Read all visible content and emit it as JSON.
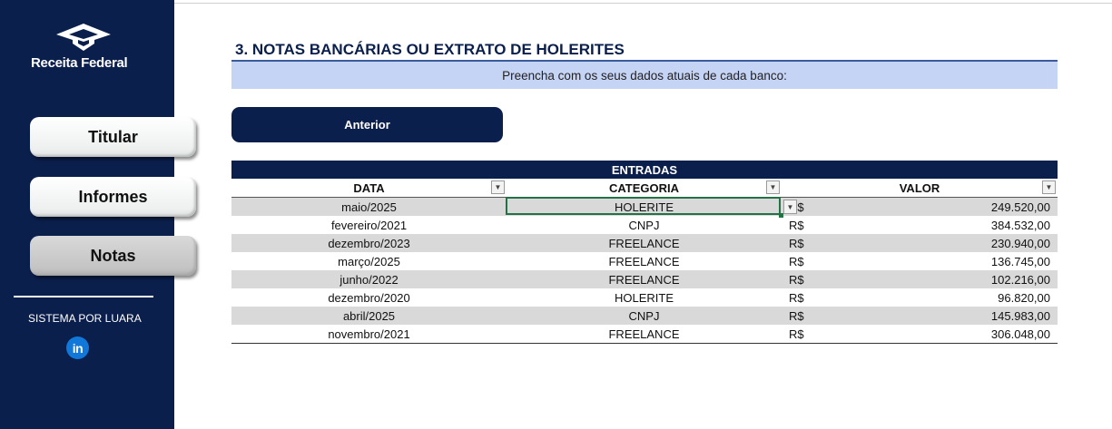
{
  "sidebar": {
    "logo_text": "Receita Federal",
    "nav": [
      {
        "label": "Titular",
        "active": false
      },
      {
        "label": "Informes",
        "active": false
      },
      {
        "label": "Notas",
        "active": true
      }
    ],
    "credit": "SISTEMA POR LUARA",
    "linkedin_icon_text": "in"
  },
  "main": {
    "title": "3. NOTAS BANCÁRIAS OU EXTRATO DE HOLERITES",
    "info": "Preencha com os seus dados atuais de cada banco:",
    "prev_button": "Anterior"
  },
  "table": {
    "header": "ENTRADAS",
    "columns": [
      "DATA",
      "CATEGORIA",
      "VALOR"
    ],
    "currency": "R$",
    "rows": [
      {
        "data": "maio/2025",
        "categoria": "HOLERITE",
        "valor": "249.520,00"
      },
      {
        "data": "fevereiro/2021",
        "categoria": "CNPJ",
        "valor": "384.532,00"
      },
      {
        "data": "dezembro/2023",
        "categoria": "FREELANCE",
        "valor": "230.940,00"
      },
      {
        "data": "março/2025",
        "categoria": "FREELANCE",
        "valor": "136.745,00"
      },
      {
        "data": "junho/2022",
        "categoria": "FREELANCE",
        "valor": "102.216,00"
      },
      {
        "data": "dezembro/2020",
        "categoria": "HOLERITE",
        "valor": "96.820,00"
      },
      {
        "data": "abril/2025",
        "categoria": "CNPJ",
        "valor": "145.983,00"
      },
      {
        "data": "novembro/2021",
        "categoria": "FREELANCE",
        "valor": "306.048,00"
      }
    ]
  },
  "colors": {
    "navy": "#0b1f4d",
    "info_bar": "#c5d3f5",
    "row_shade": "#d9d9d9",
    "selection": "#217346"
  }
}
